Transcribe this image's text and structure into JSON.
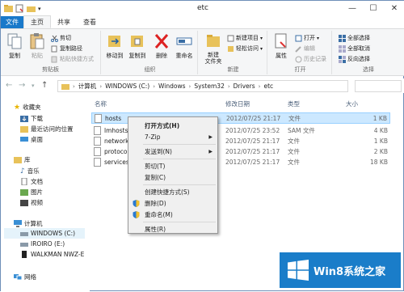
{
  "window": {
    "title": "etc"
  },
  "ribbon_tabs": [
    "文件",
    "主页",
    "共享",
    "查看"
  ],
  "ribbon": {
    "clipboard": {
      "group_label": "剪贴板",
      "copy": "复制",
      "paste": "粘贴",
      "cut": "剪切",
      "copy_path": "复制路径",
      "paste_shortcut": "粘贴快捷方式"
    },
    "organize": {
      "group_label": "组织",
      "move_to": "移动到",
      "copy_to": "复制到",
      "delete": "删除",
      "rename": "重命名"
    },
    "new": {
      "group_label": "新建",
      "new_folder": "新建\n文件夹",
      "new_item": "新建项目",
      "easy_access": "轻松访问"
    },
    "open": {
      "group_label": "打开",
      "properties": "属性",
      "open": "打开",
      "edit": "编辑",
      "history": "历史记录"
    },
    "select": {
      "group_label": "选择",
      "select_all": "全部选择",
      "select_none": "全部取消",
      "invert": "反向选择"
    }
  },
  "address": {
    "parts": [
      "计算机",
      "WINDOWS (C:)",
      "Windows",
      "System32",
      "Drivers",
      "etc"
    ]
  },
  "nav": {
    "favorites": "收藏夹",
    "downloads": "下载",
    "recent": "最近访问的位置",
    "desktop": "桌面",
    "libraries": "库",
    "music": "音乐",
    "documents": "文档",
    "pictures": "图片",
    "videos": "视频",
    "computer": "计算机",
    "drive_c": "WINDOWS (C:)",
    "drive_e": "IROIRO (E:)",
    "drive_w": "WALKMAN NWZ-E",
    "network": "网络"
  },
  "columns": {
    "name": "名称",
    "date": "修改日期",
    "type": "类型",
    "size": "大小"
  },
  "files": [
    {
      "name": "hosts",
      "date": "2012/07/25 21:17",
      "type": "文件",
      "size": "1 KB"
    },
    {
      "name": "lmhosts",
      "date": "2012/07/25 23:52",
      "type": "SAM 文件",
      "size": "4 KB"
    },
    {
      "name": "network",
      "date": "2012/07/25 21:17",
      "type": "文件",
      "size": "1 KB"
    },
    {
      "name": "protoco",
      "date": "2012/07/25 21:17",
      "type": "文件",
      "size": "2 KB"
    },
    {
      "name": "services",
      "date": "2012/07/25 21:17",
      "type": "文件",
      "size": "18 KB"
    }
  ],
  "context_menu": {
    "open_with": "打开方式(H)",
    "zip": "7-Zip",
    "send_to": "发送到(N)",
    "cut": "剪切(T)",
    "copy": "复制(C)",
    "shortcut": "创建快捷方式(S)",
    "delete": "删除(D)",
    "rename": "重命名(M)",
    "properties": "属性(R)"
  },
  "watermark": {
    "text": "Win8系统之家"
  },
  "colors": {
    "accent": "#1979ca",
    "selection": "#cce8ff",
    "watermark_bg": "#1a7dc9"
  }
}
